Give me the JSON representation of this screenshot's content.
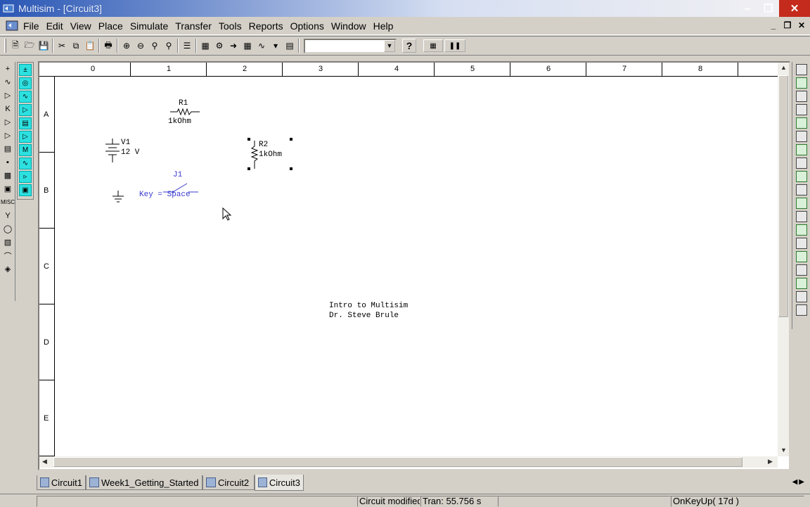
{
  "window": {
    "title": "Multisim - [Circuit3]"
  },
  "menu": {
    "items": [
      {
        "label": "File"
      },
      {
        "label": "Edit"
      },
      {
        "label": "View"
      },
      {
        "label": "Place"
      },
      {
        "label": "Simulate"
      },
      {
        "label": "Transfer"
      },
      {
        "label": "Tools"
      },
      {
        "label": "Reports"
      },
      {
        "label": "Options"
      },
      {
        "label": "Window"
      },
      {
        "label": "Help"
      }
    ]
  },
  "toolbar": {
    "combo_value": "",
    "help_label": "?"
  },
  "ruler": {
    "columns": [
      "0",
      "1",
      "2",
      "3",
      "4",
      "5",
      "6",
      "7",
      "8"
    ],
    "rows": [
      "A",
      "B",
      "C",
      "D",
      "E"
    ]
  },
  "schematic": {
    "r1": {
      "name": "R1",
      "value": "1kOhm"
    },
    "r2": {
      "name": "R2",
      "value": "1kOhm"
    },
    "v1": {
      "name": "V1",
      "value": "12 V"
    },
    "j1": {
      "name": "J1",
      "key": "Key = Space"
    },
    "note_line1": "Intro to Multisim",
    "note_line2": "Dr. Steve Brule"
  },
  "tabs": [
    {
      "label": "Circuit1"
    },
    {
      "label": "Week1_Getting_Started"
    },
    {
      "label": "Circuit2"
    },
    {
      "label": "Circuit3"
    }
  ],
  "status": {
    "modified": "Circuit modified",
    "tran": "Tran: 55.756 s",
    "event": "OnKeyUp( 17d )"
  },
  "colors": {
    "selection": "#000000",
    "switch_label": "#3a3ad0",
    "title_gradient_start": "#2a57b5"
  }
}
